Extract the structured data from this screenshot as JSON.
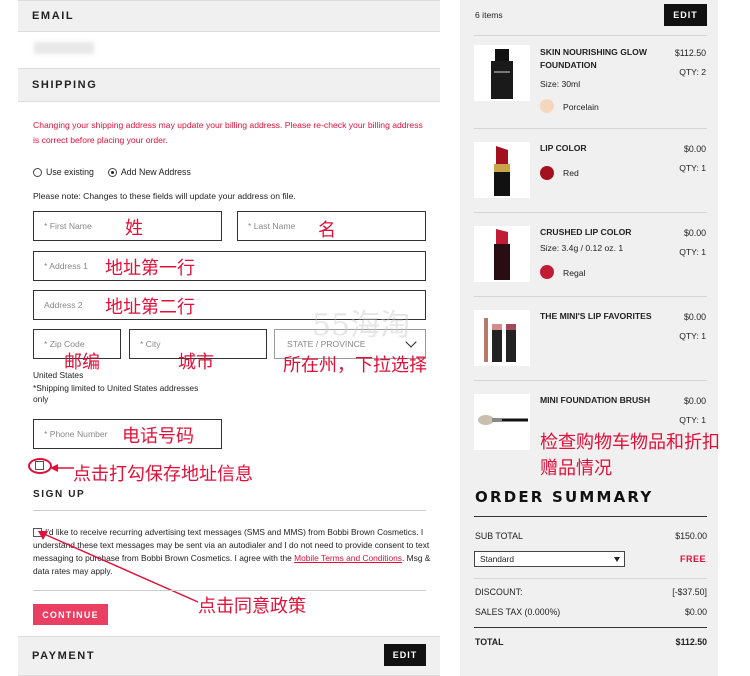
{
  "email_section": {
    "title": "EMAIL"
  },
  "shipping_section": {
    "title": "SHIPPING",
    "warning": "Changing your shipping address may update your billing address. Please re-check your billing address is correct before placing your order.",
    "radio_existing": "Use existing",
    "radio_new": "Add New Address",
    "note": "Please note: Changes to these fields will update your address on file.",
    "first_name_placeholder": "* First Name",
    "last_name_placeholder": "* Last Name",
    "address1_placeholder": "* Address 1",
    "address2_placeholder": "Address 2",
    "zip_placeholder": "* Zip Code",
    "city_placeholder": "* City",
    "state_placeholder": "STATE / PROVINCE",
    "country": "United States",
    "shipping_limit": "*Shipping limited to United States addresses only",
    "phone_placeholder": "* Phone Number"
  },
  "annotations": {
    "first_name": "姓",
    "last_name": "名",
    "address1": "地址第一行",
    "address2": "地址第二行",
    "zip": "邮编",
    "city": "城市",
    "state": "所在州，下拉选择",
    "phone": "电话号码",
    "save_address": "点击打勾保存地址信息",
    "agree_policy": "点击同意政策",
    "check_cart": "检查购物车物品和折扣赠品情况"
  },
  "watermark": "55海淘",
  "signup_section": {
    "title": "SIGN UP",
    "consent_text": "I'd like to receive recurring advertising text messages (SMS and MMS) from Bobbi Brown Cosmetics. I understand these text messages may be sent via an autodialer and I do not need to provide consent to text messaging to purchase from Bobbi Brown Cosmetics. I agree with the ",
    "consent_link": "Mobile Terms and Conditions",
    "consent_tail": ". Msg & data rates may apply.",
    "continue_label": "CONTINUE"
  },
  "payment_section": {
    "title": "PAYMENT",
    "edit_label": "EDIT"
  },
  "cart": {
    "items_count": "6 items",
    "edit_label": "EDIT",
    "items": [
      {
        "name": "SKIN NOURISHING GLOW FOUNDATION",
        "size": "Size: 30ml",
        "shade": "Porcelain",
        "shade_color": "#f6d6bd",
        "price": "$112.50",
        "qty": "QTY: 2"
      },
      {
        "name": "LIP COLOR",
        "size": "",
        "shade": "Red",
        "shade_color": "#a3111e",
        "price": "$0.00",
        "qty": "QTY: 1"
      },
      {
        "name": "CRUSHED LIP COLOR",
        "size": "Size: 3.4g / 0.12 oz. 1",
        "shade": "Regal",
        "shade_color": "#c01d35",
        "price": "$0.00",
        "qty": "QTY: 1"
      },
      {
        "name": "THE MINI'S LIP FAVORITES",
        "size": "",
        "shade": "",
        "shade_color": "",
        "price": "$0.00",
        "qty": "QTY: 1"
      },
      {
        "name": "MINI FOUNDATION BRUSH",
        "size": "",
        "shade": "",
        "shade_color": "",
        "price": "$0.00",
        "qty": "QTY: 1"
      }
    ]
  },
  "order_summary": {
    "title": "ORDER SUMMARY",
    "subtotal_label": "SUB TOTAL",
    "subtotal_value": "$150.00",
    "shipping_method": "Standard",
    "shipping_value": "FREE",
    "discount_label": "DISCOUNT:",
    "discount_value": "[-$37.50]",
    "tax_label": "SALES TAX (0.000%)",
    "tax_value": "$0.00",
    "total_label": "TOTAL",
    "total_value": "$112.50"
  },
  "colors": {
    "accent": "#e0103a",
    "button": "#ea3e62",
    "panel": "#f0f0f0"
  }
}
